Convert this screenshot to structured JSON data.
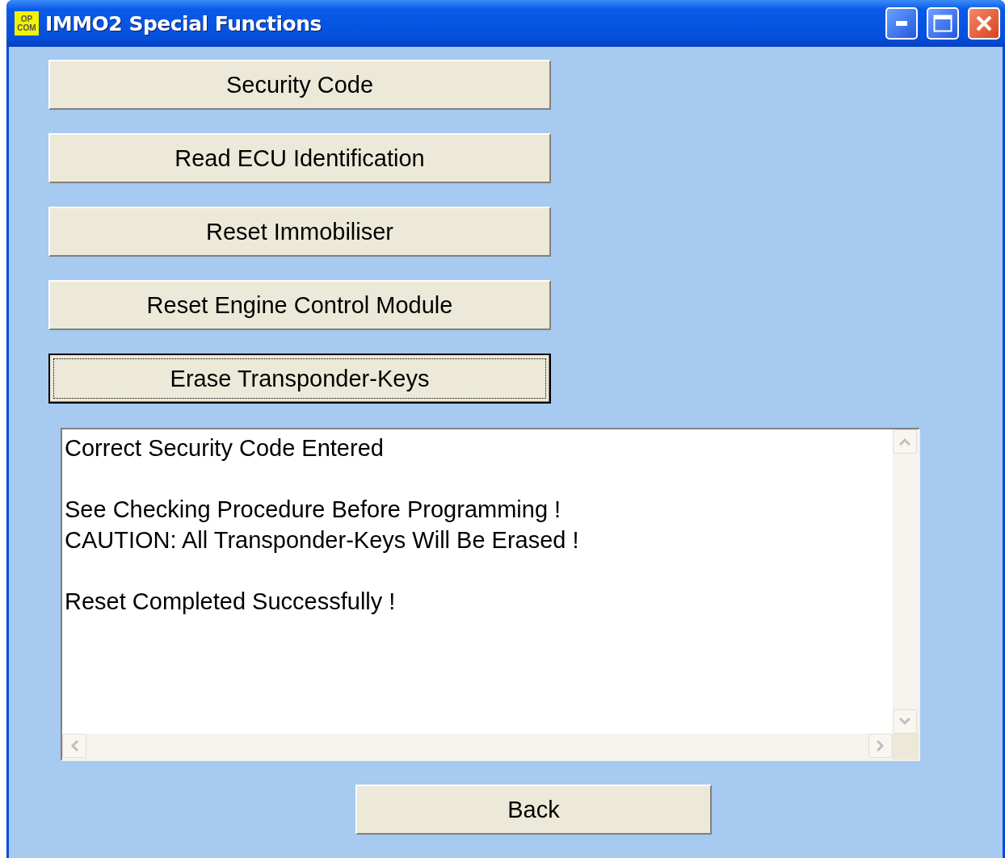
{
  "window": {
    "title": "IMMO2 Special Functions",
    "logo": [
      "OP",
      "COM"
    ]
  },
  "buttons": [
    {
      "label": "Security Code",
      "focused": false
    },
    {
      "label": "Read ECU Identification",
      "focused": false
    },
    {
      "label": "Reset Immobiliser",
      "focused": false
    },
    {
      "label": "Reset Engine Control Module",
      "focused": false
    },
    {
      "label": "Erase Transponder-Keys",
      "focused": true
    }
  ],
  "log": {
    "blocks": [
      [
        "Correct Security Code Entered"
      ],
      [
        "See Checking Procedure Before Programming !",
        "CAUTION: All Transponder-Keys Will Be Erased !"
      ],
      [
        "Reset Completed Successfully !"
      ]
    ]
  },
  "back_button": {
    "label": "Back"
  }
}
